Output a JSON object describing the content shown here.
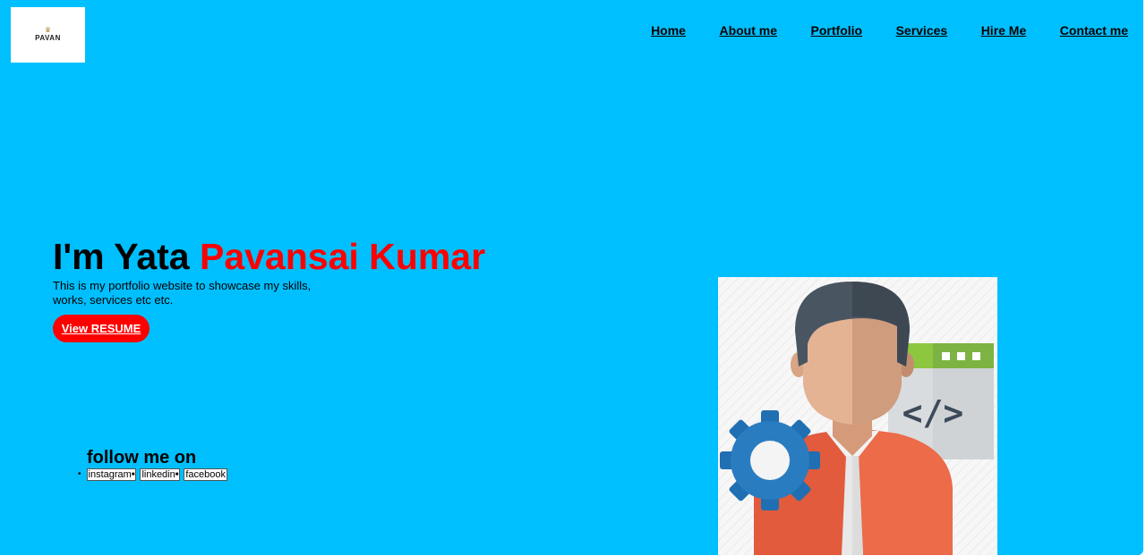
{
  "logo": {
    "text": "PAVAN",
    "crown": "♛"
  },
  "nav": {
    "items": [
      {
        "label": "Home"
      },
      {
        "label": "About me"
      },
      {
        "label": "Portfolio"
      },
      {
        "label": "Services"
      },
      {
        "label": "Hire Me"
      },
      {
        "label": "Contact me"
      }
    ]
  },
  "hero": {
    "title_prefix": "I'm Yata ",
    "title_name": "Pavansai Kumar",
    "description": "This is my portfolio website to showcase my skills, works, services etc etc.",
    "resume_label": "View RESUME"
  },
  "follow": {
    "title": "follow me on",
    "links": [
      {
        "label": "instagram"
      },
      {
        "label": "linkedin"
      },
      {
        "label": "facebook"
      }
    ]
  },
  "illustration": {
    "icon": "developer-illustration",
    "code_glyph": "</>"
  },
  "colors": {
    "background": "#00bfff",
    "accent": "#ff0000",
    "button_text": "#ffffff"
  }
}
